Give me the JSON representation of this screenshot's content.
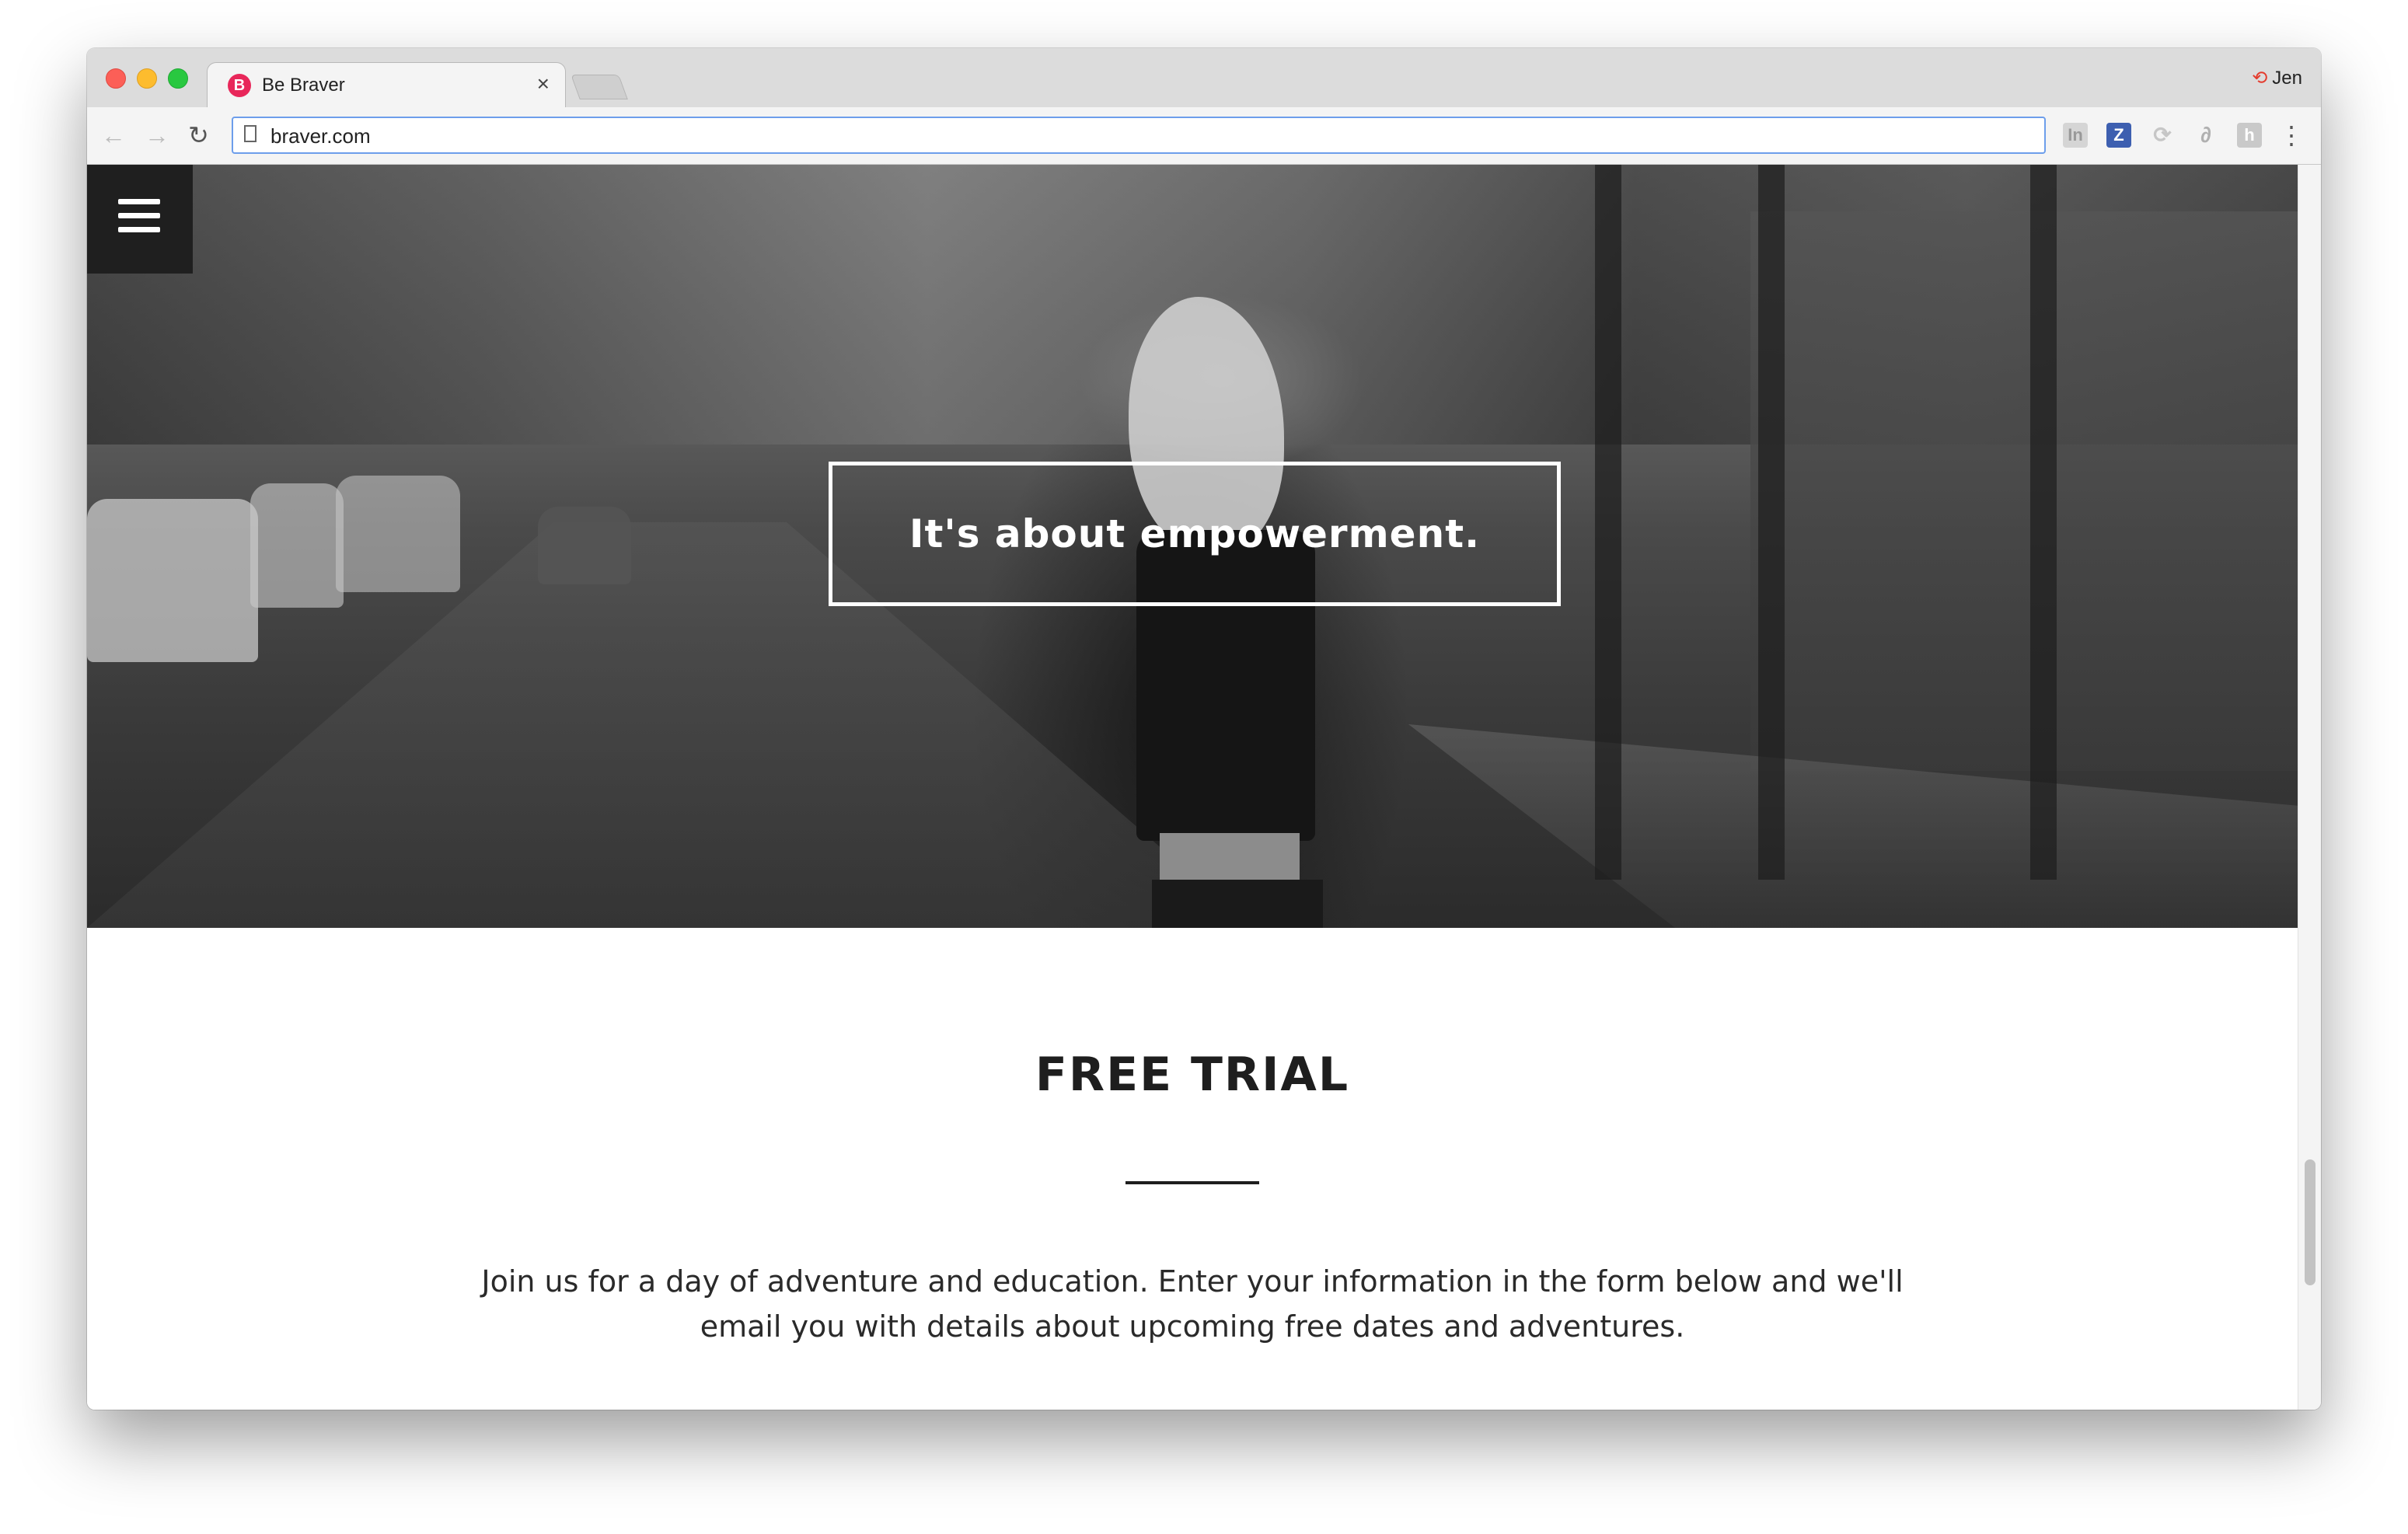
{
  "window": {
    "tab": {
      "title": "Be Braver",
      "favicon_letter": "B",
      "close_label": "×"
    },
    "profile": {
      "name": "Jen",
      "icon": "sync-error-icon"
    }
  },
  "toolbar": {
    "back_icon": "←",
    "forward_icon": "→",
    "reload_icon": "↻",
    "url": "braver.com",
    "extensions": [
      {
        "name": "in-icon",
        "glyph": "In"
      },
      {
        "name": "z-extension-icon",
        "glyph": "Z"
      },
      {
        "name": "puzzle-extension-icon",
        "glyph": "⟳"
      },
      {
        "name": "link-extension-icon",
        "glyph": "∂"
      },
      {
        "name": "box-extension-icon",
        "glyph": "h"
      }
    ],
    "menu_icon": "⋮"
  },
  "hero": {
    "menu_icon": "hamburger-menu-icon",
    "headline": "It's about empowerment."
  },
  "section": {
    "title": "FREE TRIAL",
    "body": "Join us for a day of adventure and education. Enter your information in the form below and we'll email you with details about upcoming free dates and adventures."
  },
  "colors": {
    "brand_pink": "#e8275a",
    "omnibox_focus": "#6d9eeb",
    "text_dark": "#1e1e1e"
  }
}
